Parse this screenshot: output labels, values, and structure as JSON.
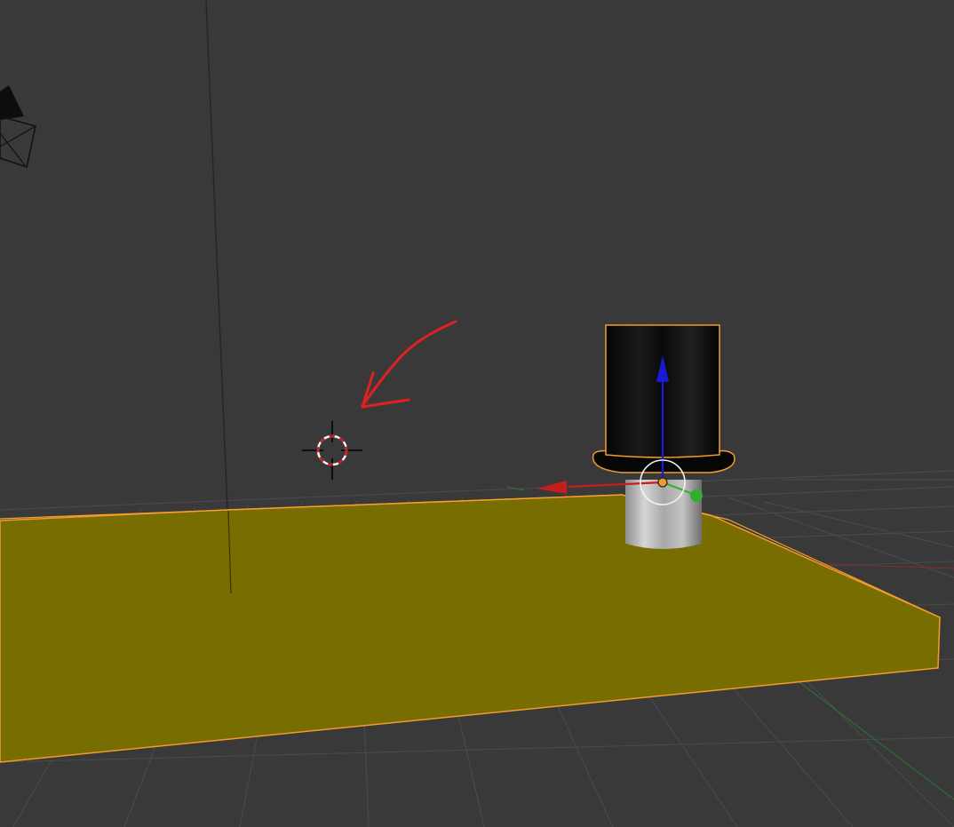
{
  "viewport": {
    "mode": "3D Viewport",
    "background_color": "#393939"
  },
  "colors": {
    "grid": "#4a4a4a",
    "plane_fill": "#786d00",
    "selection_outline": "#f39b2a",
    "axis_x": "#c61d1d",
    "axis_y": "#2fae2f",
    "axis_z": "#1a1ad6",
    "annotation": "#e32020"
  },
  "scene_objects": [
    {
      "name": "camera",
      "icon": "camera-icon",
      "selected": false
    },
    {
      "name": "plane",
      "selected": true
    },
    {
      "name": "top-hat",
      "selected": true,
      "active": true
    }
  ],
  "cursor_3d": {
    "icon": "crosshair-icon"
  },
  "annotation": {
    "icon": "arrow-icon",
    "points_to": "3d-cursor"
  },
  "manipulator": {
    "mode": "translate",
    "axes": [
      "X",
      "Y",
      "Z"
    ]
  }
}
